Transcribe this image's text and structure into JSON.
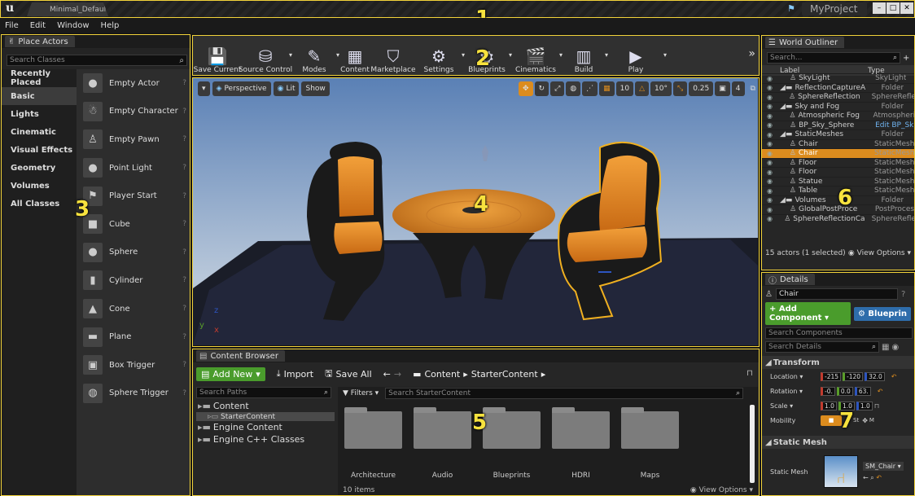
{
  "window": {
    "logo": "u",
    "tab": "Minimal_Default",
    "project": "MyProject",
    "controls": [
      "–",
      "□",
      "✕"
    ]
  },
  "menu": [
    "File",
    "Edit",
    "Window",
    "Help"
  ],
  "callouts": [
    "1",
    "2",
    "3",
    "4",
    "5",
    "6",
    "7"
  ],
  "place_actors": {
    "tab": "Place Actors",
    "search_placeholder": "Search Classes",
    "categories": [
      "Recently Placed",
      "Basic",
      "Lights",
      "Cinematic",
      "Visual Effects",
      "Geometry",
      "Volumes",
      "All Classes"
    ],
    "selected_category": "Basic",
    "items": [
      "Empty Actor",
      "Empty Character",
      "Empty Pawn",
      "Point Light",
      "Player Start",
      "Cube",
      "Sphere",
      "Cylinder",
      "Cone",
      "Plane",
      "Box Trigger",
      "Sphere Trigger"
    ]
  },
  "toolbar": {
    "buttons": [
      {
        "label": "Save Current",
        "icon": "save-icon"
      },
      {
        "label": "Source Control",
        "icon": "source-control-icon"
      },
      {
        "label": "Modes",
        "icon": "modes-icon"
      },
      {
        "label": "Content",
        "icon": "content-icon"
      },
      {
        "label": "Marketplace",
        "icon": "marketplace-icon"
      },
      {
        "label": "Settings",
        "icon": "settings-icon"
      },
      {
        "label": "Blueprints",
        "icon": "blueprints-icon"
      },
      {
        "label": "Cinematics",
        "icon": "cinematics-icon"
      },
      {
        "label": "Build",
        "icon": "build-icon"
      },
      {
        "label": "Play",
        "icon": "play-icon"
      }
    ],
    "overflow": "»"
  },
  "viewport": {
    "perspective": "Perspective",
    "lit": "Lit",
    "show": "Show",
    "grid_snap": "10",
    "rot_snap": "10°",
    "scale_snap": "0.25",
    "cam_speed": "4",
    "axis_z": "z",
    "axis_x": "x",
    "axis_y": "y"
  },
  "content_browser": {
    "tab": "Content Browser",
    "add_new": "Add New",
    "import": "Import",
    "save_all": "Save All",
    "path": [
      "Content",
      "StarterContent"
    ],
    "search_paths_placeholder": "Search Paths",
    "filters": "Filters",
    "search_placeholder": "Search StarterContent",
    "tree": [
      {
        "label": "Content",
        "level": 0
      },
      {
        "label": "StarterContent",
        "level": 1
      },
      {
        "label": "Engine Content",
        "level": 0
      },
      {
        "label": "Engine C++ Classes",
        "level": 0
      }
    ],
    "folders": [
      "Architecture",
      "Audio",
      "Blueprints",
      "HDRI",
      "Maps"
    ],
    "item_count": "10 items",
    "view_options": "View Options"
  },
  "world_outliner": {
    "tab": "World Outliner",
    "search_placeholder": "Search...",
    "col_label": "Label",
    "col_type": "Type",
    "rows": [
      {
        "label": "SkyLight",
        "type": "SkyLight",
        "indent": 3
      },
      {
        "label": "ReflectionCaptureA",
        "type": "Folder",
        "indent": 1,
        "folder": true
      },
      {
        "label": "SphereReflection",
        "type": "SphereRefle",
        "indent": 3
      },
      {
        "label": "Sky and Fog",
        "type": "Folder",
        "indent": 1,
        "folder": true
      },
      {
        "label": "Atmospheric Fog",
        "type": "Atmospheri",
        "indent": 3
      },
      {
        "label": "BP_Sky_Sphere",
        "type": "Edit BP_Sk",
        "indent": 3,
        "link": true
      },
      {
        "label": "StaticMeshes",
        "type": "Folder",
        "indent": 1,
        "folder": true
      },
      {
        "label": "Chair",
        "type": "StaticMesh",
        "indent": 3
      },
      {
        "label": "Chair",
        "type": "StaticMesh",
        "indent": 3,
        "selected": true
      },
      {
        "label": "Floor",
        "type": "StaticMesh",
        "indent": 3
      },
      {
        "label": "Floor",
        "type": "StaticMesh",
        "indent": 3
      },
      {
        "label": "Statue",
        "type": "StaticMesh",
        "indent": 3
      },
      {
        "label": "Table",
        "type": "StaticMesh",
        "indent": 3
      },
      {
        "label": "Volumes",
        "type": "Folder",
        "indent": 1,
        "folder": true
      },
      {
        "label": "GlobalPostProce",
        "type": "PostProces",
        "indent": 3
      },
      {
        "label": "SphereReflectionCa",
        "type": "SphereRefle",
        "indent": 2
      }
    ],
    "status": "15 actors (1 selected)",
    "view_options": "View Options"
  },
  "details": {
    "tab": "Details",
    "name": "Chair",
    "add_component": "+ Add Component",
    "blueprint": "Blueprin",
    "search_components": "Search Components",
    "search_details": "Search Details",
    "transform": "Transform",
    "location_label": "Location",
    "location": [
      "-215",
      "-120",
      "32.0"
    ],
    "rotation_label": "Rotation",
    "rotation": [
      "-0.",
      "0.0",
      "63."
    ],
    "scale_label": "Scale",
    "scale": [
      "1.0",
      "1.0",
      "1.0"
    ],
    "mobility_label": "Mobility",
    "mobility": [
      "St",
      "M"
    ],
    "static_mesh_header": "Static Mesh",
    "static_mesh_label": "Static Mesh",
    "static_mesh_value": "SM_Chair"
  },
  "colors": {
    "accent": "#f2d33a",
    "selection": "#dc8c1e",
    "add_new": "#4a9c2c",
    "blueprint": "#2e6dab",
    "x": "#c23b2e",
    "y": "#5a9e2a",
    "z": "#2d55c0"
  }
}
